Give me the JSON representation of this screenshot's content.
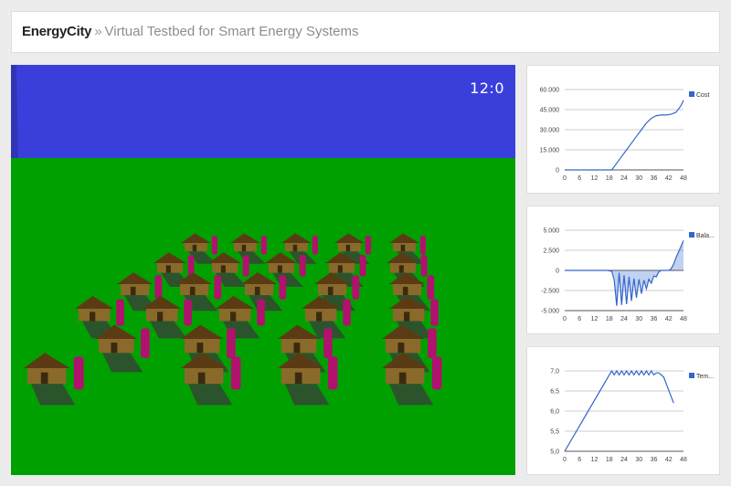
{
  "header": {
    "brand": "EnergyCity",
    "separator": "»",
    "subtitle": "Virtual Testbed for Smart Energy Systems"
  },
  "scene": {
    "clock": "12:0",
    "colors": {
      "sky": "#3a3fdc",
      "ground": "#00a000",
      "roof": "#5b3b14",
      "wall": "#8a6a2a",
      "battery": "#b0126e"
    }
  },
  "chart_data": [
    {
      "type": "line",
      "series": [
        {
          "name": "Cost",
          "color": "#3366cc",
          "x": [
            0,
            17,
            19,
            21,
            23,
            25,
            27,
            29,
            31,
            33,
            35,
            37,
            39,
            41,
            43,
            45,
            47,
            48
          ],
          "values": [
            0,
            0,
            0,
            5000,
            10000,
            15000,
            20000,
            25000,
            30000,
            35000,
            38500,
            40500,
            41000,
            41000,
            41500,
            43000,
            48000,
            52000
          ]
        }
      ],
      "yticks": [
        "60.000",
        "45.000",
        "30.000",
        "15.000",
        "0"
      ],
      "ylim": [
        0,
        60000
      ],
      "xticks": [
        "0",
        "6",
        "12",
        "18",
        "24",
        "30",
        "36",
        "42",
        "48"
      ],
      "xlim": [
        0,
        48
      ],
      "legend": "right"
    },
    {
      "type": "area",
      "series": [
        {
          "name": "Bala...",
          "color": "#3366cc",
          "x": [
            0,
            17,
            19,
            20,
            21,
            22,
            23,
            24,
            25,
            26,
            27,
            28,
            29,
            30,
            31,
            32,
            33,
            34,
            35,
            36,
            37,
            38,
            39,
            40,
            41,
            42,
            43,
            44,
            45,
            46,
            47,
            48
          ],
          "values": [
            0,
            0,
            -100,
            -1200,
            -4400,
            -300,
            -4300,
            -600,
            -4200,
            -800,
            -3800,
            -1000,
            -3400,
            -1100,
            -2900,
            -1200,
            -2300,
            -1100,
            -1600,
            -700,
            -800,
            -200,
            0,
            0,
            0,
            0,
            200,
            800,
            1600,
            2300,
            3000,
            3700
          ]
        }
      ],
      "yticks": [
        "5.000",
        "2.500",
        "0",
        "-2.500",
        "-5.000"
      ],
      "ylim": [
        -5000,
        5000
      ],
      "xticks": [
        "0",
        "6",
        "12",
        "18",
        "24",
        "30",
        "36",
        "42",
        "48"
      ],
      "xlim": [
        0,
        48
      ],
      "legend": "right"
    },
    {
      "type": "line",
      "series": [
        {
          "name": "Tem...",
          "color": "#3366cc",
          "x": [
            0,
            18,
            19,
            20,
            21,
            22,
            23,
            24,
            25,
            26,
            27,
            28,
            29,
            30,
            31,
            32,
            33,
            34,
            35,
            36,
            37,
            38,
            39,
            40,
            44
          ],
          "values": [
            5.0,
            6.9,
            7.0,
            6.9,
            7.0,
            6.9,
            7.0,
            6.9,
            7.0,
            6.9,
            7.0,
            6.9,
            7.0,
            6.9,
            7.0,
            6.9,
            7.0,
            6.9,
            7.0,
            6.9,
            6.95,
            6.95,
            6.9,
            6.85,
            6.2
          ]
        }
      ],
      "yticks": [
        "7,0",
        "6,5",
        "6,0",
        "5,5",
        "5,0"
      ],
      "ylim": [
        5.0,
        7.0
      ],
      "xticks": [
        "0",
        "6",
        "12",
        "18",
        "24",
        "30",
        "36",
        "42",
        "48"
      ],
      "xlim": [
        0,
        48
      ],
      "legend": "right"
    }
  ]
}
